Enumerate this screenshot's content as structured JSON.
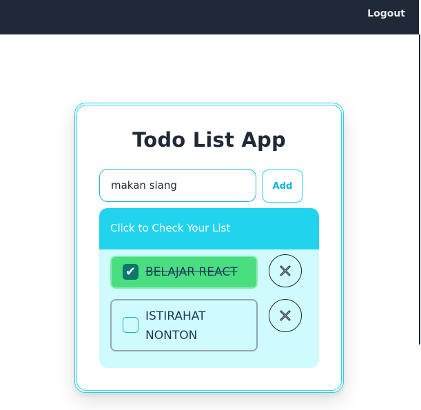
{
  "navbar": {
    "logout_label": "Logout"
  },
  "app": {
    "title": "Todo List App",
    "input": {
      "value": "makan siang",
      "placeholder": ""
    },
    "add_label": "Add",
    "list_header": "Click to Check Your List",
    "items": [
      {
        "label": "BELAJAR REACT",
        "checked": true
      },
      {
        "label": "ISTIRAHAT NONTON",
        "checked": false
      }
    ]
  },
  "colors": {
    "navbar": "#1f2937",
    "accent": "#22d3ee",
    "list_background": "#cffafe",
    "checked_item": "#4ade80"
  },
  "icons": {
    "check": "check-icon",
    "delete": "close-x-icon"
  }
}
